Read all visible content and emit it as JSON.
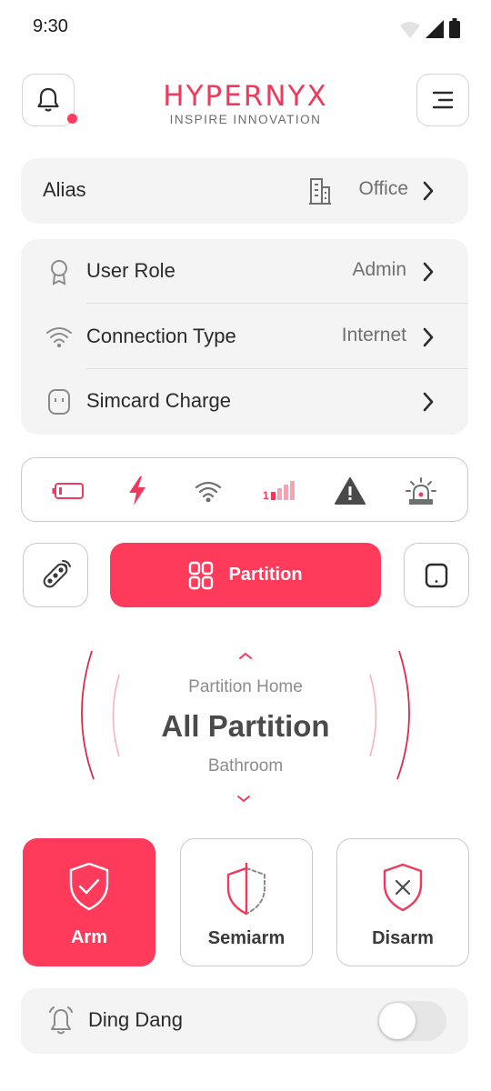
{
  "status_bar": {
    "time": "9:30"
  },
  "header": {
    "logo_main": "HYPERNYX",
    "logo_sub": "INSPIRE INNOVATION"
  },
  "alias": {
    "label": "Alias",
    "value": "Office"
  },
  "info_rows": [
    {
      "label": "User Role",
      "value": "Admin",
      "icon": "award-icon"
    },
    {
      "label": "Connection Type",
      "value": "Internet",
      "icon": "wifi-icon"
    },
    {
      "label": "Simcard Charge",
      "value": "",
      "icon": "simcard-icon"
    }
  ],
  "status_icons": [
    "battery-icon",
    "power-icon",
    "wifi-icon",
    "signal-icon",
    "warning-icon",
    "siren-icon"
  ],
  "mode": {
    "main_label": "Partition"
  },
  "partition": {
    "above": "Partition Home",
    "current": "All Partition",
    "below": "Bathroom"
  },
  "actions": [
    {
      "label": "Arm",
      "active": true
    },
    {
      "label": "Semiarm",
      "active": false
    },
    {
      "label": "Disarm",
      "active": false
    }
  ],
  "ding": {
    "label": "Ding Dang",
    "enabled": false
  },
  "colors": {
    "accent": "#ff3b5c",
    "card_bg": "#f4f4f4",
    "border": "#c9c9c9"
  }
}
